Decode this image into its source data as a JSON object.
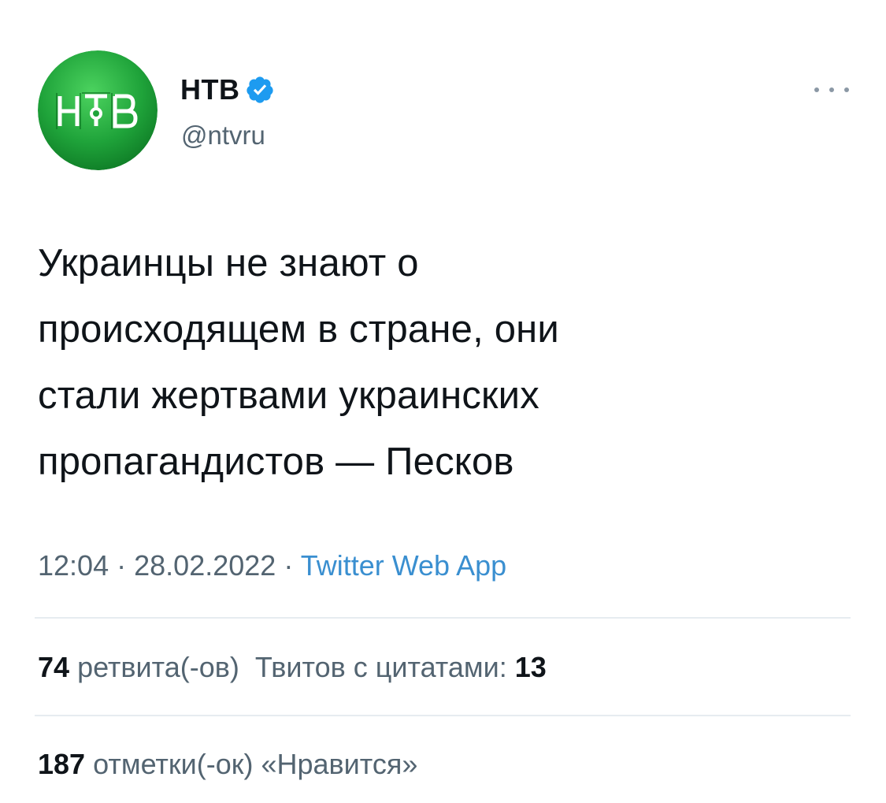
{
  "account": {
    "name": "НТВ",
    "handle": "@ntvru",
    "avatar_icon": "ntv-logo",
    "verified_icon": "verified-badge-icon",
    "brand_color": "#1fa33a",
    "verified_color": "#1d9bf0"
  },
  "tweet": {
    "text": "Украинцы не знают о\nпроисходящем в стране, они\nстали жертвами украинских\nпропагандистов — Песков",
    "time": "12:04",
    "date": "28.02.2022",
    "separator": "·",
    "source": "Twitter Web App"
  },
  "stats": {
    "retweets_count": "74",
    "retweets_label": "ретвита(-ов)",
    "quotes_label": "Твитов с цитатами:",
    "quotes_count": "13",
    "likes_count": "187",
    "likes_label": "отметки(-ок) «Нравится»"
  }
}
